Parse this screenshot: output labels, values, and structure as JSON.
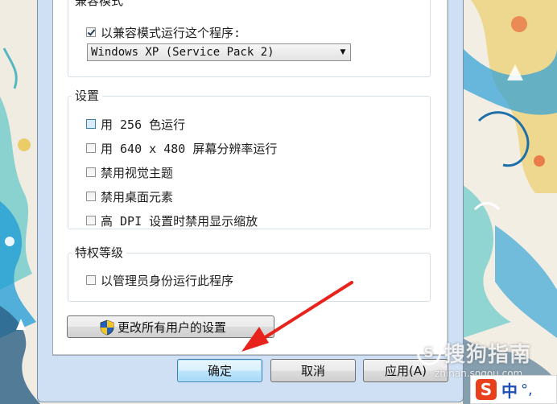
{
  "compat": {
    "group_title": "兼容模式",
    "run_in_compat_label": "以兼容模式运行这个程序:",
    "run_in_compat_checked": true,
    "os_selected": "Windows XP (Service Pack 2)"
  },
  "settings": {
    "group_title": "设置",
    "items": [
      {
        "label": "用 256 色运行",
        "checked": false
      },
      {
        "label": "用 640 x 480 屏幕分辨率运行",
        "checked": false
      },
      {
        "label": "禁用视觉主题",
        "checked": false
      },
      {
        "label": "禁用桌面元素",
        "checked": false
      },
      {
        "label": "高 DPI 设置时禁用显示缩放",
        "checked": false
      }
    ]
  },
  "privilege": {
    "group_title": "特权等级",
    "run_as_admin_label": "以管理员身份运行此程序",
    "run_as_admin_checked": false
  },
  "change_all_users_label": "更改所有用户的设置",
  "buttons": {
    "ok": "确定",
    "cancel": "取消",
    "apply": "应用(A)"
  },
  "watermark": {
    "brand": "搜狗指南",
    "site": "zhinan.sogou.com"
  },
  "ime": {
    "logo": "S",
    "mode": "中",
    "punct": "°,"
  },
  "colors": {
    "arrow": "#e8231b",
    "default_button_border": "#3c7fb1"
  }
}
